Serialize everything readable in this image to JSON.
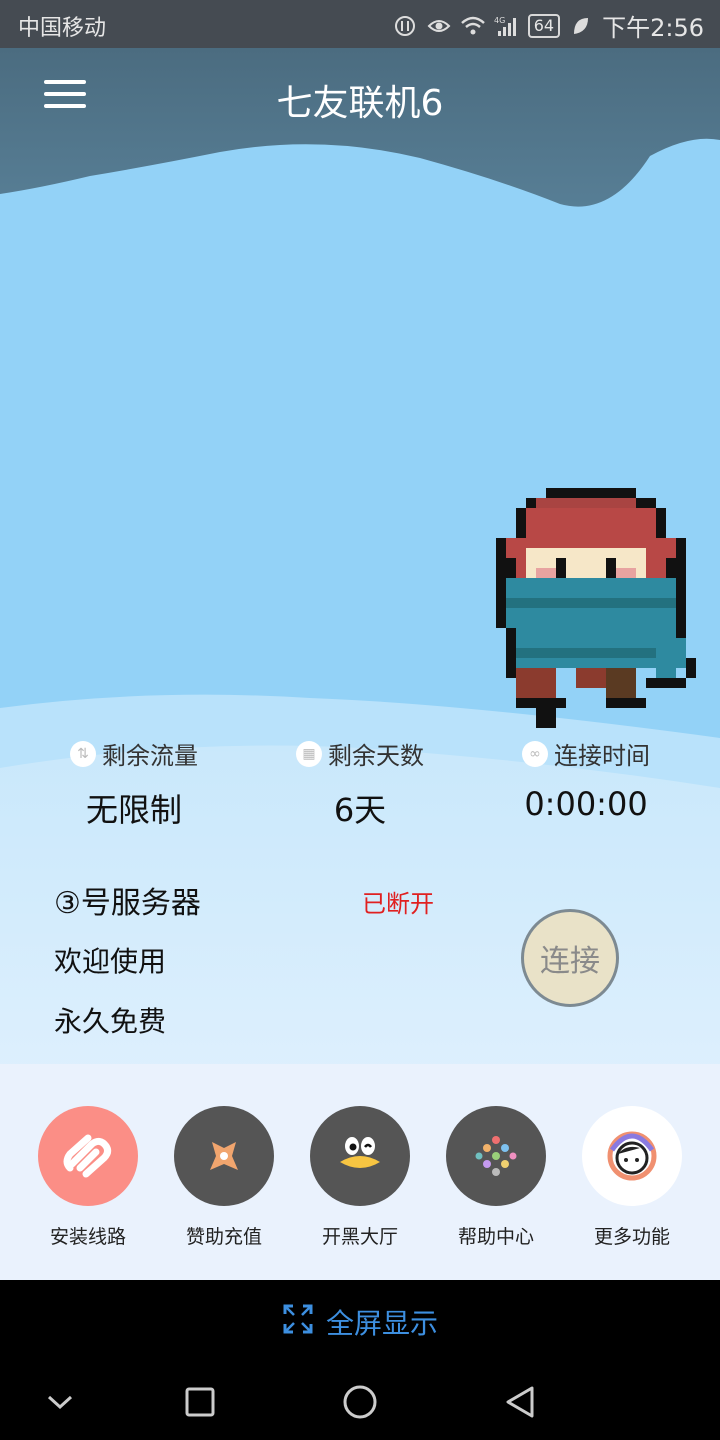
{
  "status_bar": {
    "carrier": "中国移动",
    "battery": "64",
    "time": "下午2:56"
  },
  "header": {
    "title": "七友联机6"
  },
  "stats": [
    {
      "label": "剩余流量",
      "value": "无限制"
    },
    {
      "label": "剩余天数",
      "value": "6天"
    },
    {
      "label": "连接时间",
      "value": "0:00:00"
    }
  ],
  "server": {
    "name": "③号服务器",
    "status": "已断开",
    "line1": "欢迎使用",
    "line2": "永久免费",
    "connect_label": "连接"
  },
  "toolbar": [
    {
      "label": "安装线路",
      "icon": "link-icon",
      "color": "#fb8e86"
    },
    {
      "label": "赞助充值",
      "icon": "sponsor-icon",
      "color": "#555555"
    },
    {
      "label": "开黑大厅",
      "icon": "qq-penguin-icon",
      "color": "#555555"
    },
    {
      "label": "帮助中心",
      "icon": "dots-icon",
      "color": "#555555"
    },
    {
      "label": "更多功能",
      "icon": "face-icon",
      "color": "#ffffff"
    }
  ],
  "fullscreen_label": "全屏显示",
  "colors": {
    "status_bar": "#454b52",
    "header_wave": "#50758b",
    "sky": "#93d2f7",
    "status_red": "#e02020",
    "fullscreen_blue": "#3d8fe0"
  }
}
